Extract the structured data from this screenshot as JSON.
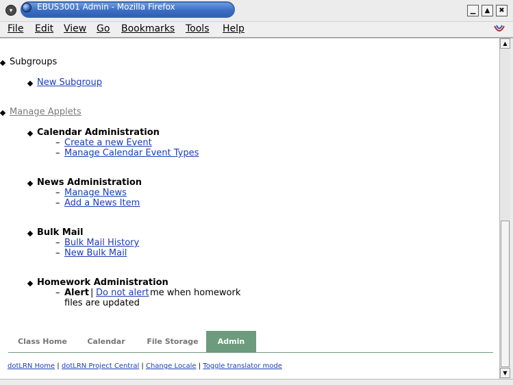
{
  "window": {
    "title": "EBUS3001 Admin - Mozilla Firefox",
    "menu_icon": "chevron-down-icon",
    "minimize_icon": "minimize-icon",
    "maximize_icon": "maximize-icon",
    "close_icon": "close-icon"
  },
  "menubar": {
    "items": [
      "File",
      "Edit",
      "View",
      "Go",
      "Bookmarks",
      "Tools",
      "Help"
    ]
  },
  "content": {
    "subgroups": {
      "heading": "Subgroups",
      "new_subgroup": "New Subgroup"
    },
    "manage_applets": "Manage Applets",
    "applets": [
      {
        "title": "Calendar Administration",
        "links": [
          "Create a new Event",
          "Manage Calendar Event Types"
        ]
      },
      {
        "title": "News Administration",
        "links": [
          "Manage News",
          "Add a News Item"
        ]
      },
      {
        "title": "Bulk Mail",
        "links": [
          "Bulk Mail History",
          "New Bulk Mail"
        ]
      },
      {
        "title": "Homework Administration",
        "alert_bold": "Alert",
        "alert_separator": "|",
        "alert_link": "Do not alert",
        "alert_rest_line1": "me when homework",
        "alert_rest_line2": "files are updated"
      }
    ]
  },
  "tabs": [
    {
      "label": "Class Home",
      "active": false
    },
    {
      "label": "Calendar",
      "active": false
    },
    {
      "label": "File Storage",
      "active": false
    },
    {
      "label": "Admin",
      "active": true
    }
  ],
  "footer": {
    "links": [
      "dotLRN Home",
      "dotLRN Project Central",
      "Change Locale",
      "Toggle translator mode"
    ],
    "separator": "|"
  },
  "colors": {
    "title_bar": "#3c6fc4",
    "link": "#1a3cba",
    "active_tab": "#6c9b7e",
    "inactive_tab_text": "#757575"
  }
}
